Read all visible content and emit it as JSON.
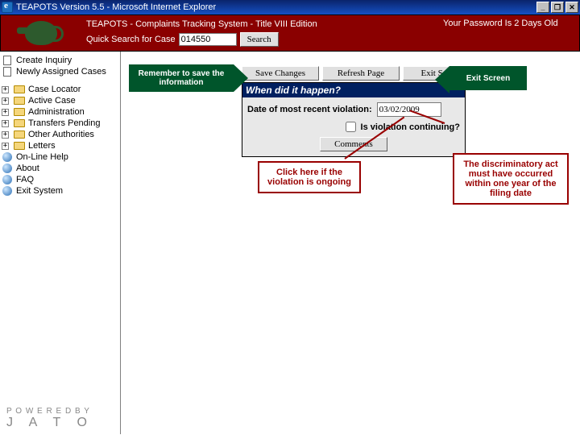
{
  "window": {
    "title": "TEAPOTS Version 5.5 - Microsoft Internet Explorer",
    "min": "_",
    "max": "❐",
    "close": "✕"
  },
  "header": {
    "app_title": "TEAPOTS - Complaints Tracking System - Title VIII Edition",
    "quick_search_label": "Quick Search for Case",
    "case_value": "014550",
    "search_btn": "Search",
    "pw_msg": "Your Password Is 2 Days Old"
  },
  "sidebar": {
    "create": "Create Inquiry",
    "newly": "Newly Assigned Cases",
    "tree": [
      "Case Locator",
      "Active Case",
      "Administration",
      "Transfers Pending",
      "Other Authorities",
      "Letters"
    ],
    "help": "On-Line Help",
    "about": "About",
    "faq": "FAQ",
    "exit": "Exit System",
    "powered": "P O W E R E D   B Y",
    "jato": "J A T O"
  },
  "toolbar": {
    "save": "Save Changes",
    "refresh": "Refresh Page",
    "exit": "Exit Screen"
  },
  "panel": {
    "title": "When did it happen?",
    "date_label": "Date of most recent violation:",
    "date_value": "03/02/2009",
    "cont_label": "Is violation continuing?",
    "comments_btn": "Comments"
  },
  "callouts": {
    "remember": "Remember to save the information",
    "exit": "Exit Screen",
    "ongoing": "Click here if the violation is ongoing",
    "rule": "The discriminatory act must have occurred within one year of the filing date"
  }
}
